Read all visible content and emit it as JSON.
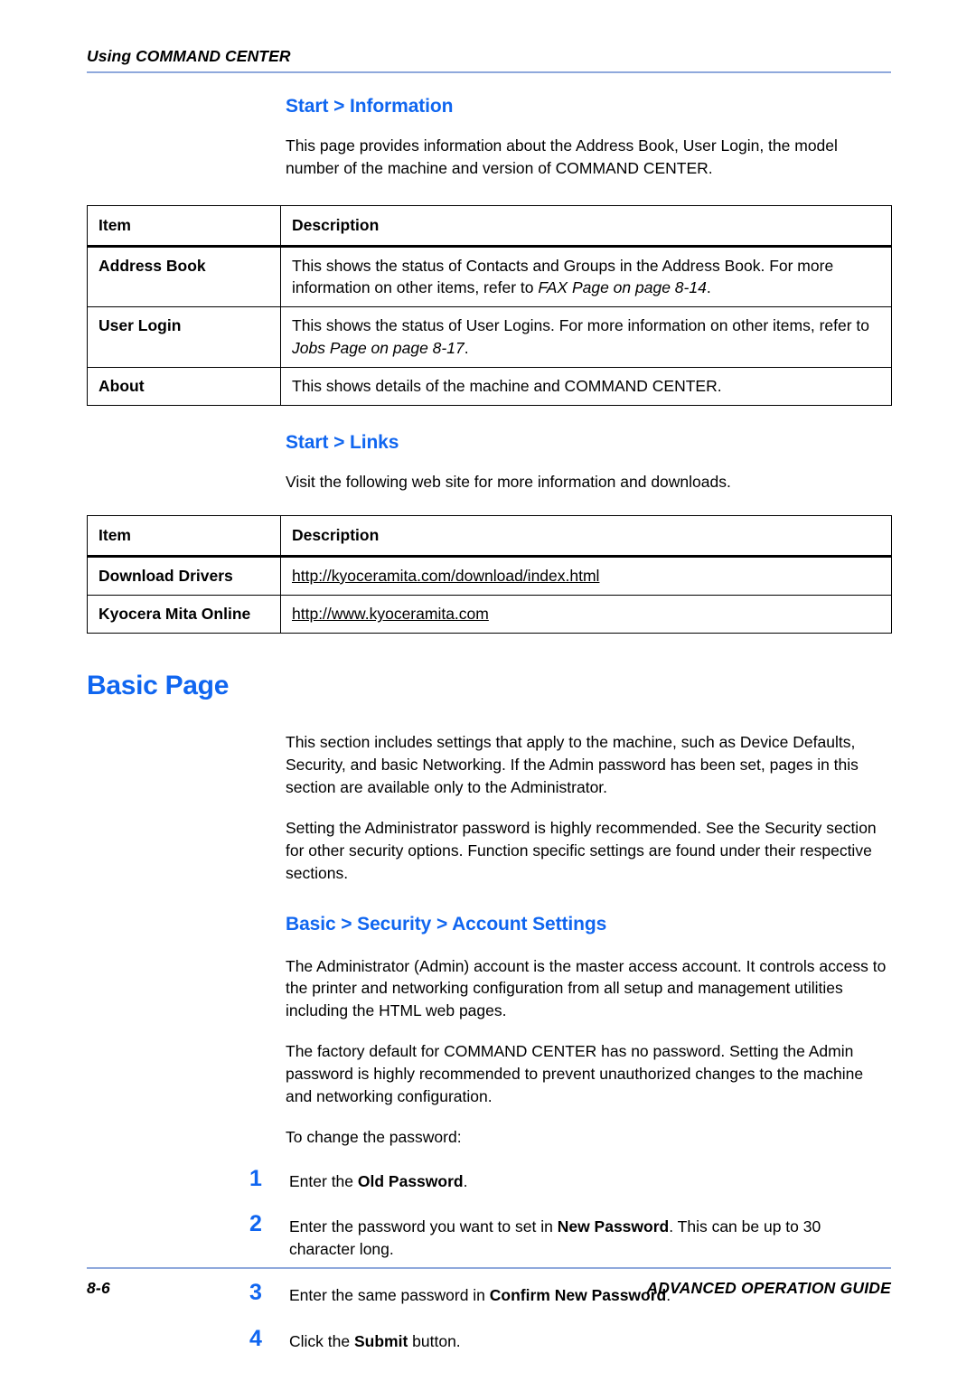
{
  "header": {
    "running_title": "Using COMMAND CENTER",
    "rule_color": "#8FA9DC"
  },
  "colors": {
    "heading_blue": "#1066F0",
    "rule_blue": "#8FA9DC",
    "text_black": "#000000"
  },
  "sections": {
    "start_information": {
      "heading": "Start > Information",
      "intro": "This page provides information about the Address Book, User Login, the model number of the machine and version of COMMAND CENTER.",
      "table": {
        "columns": [
          "Item",
          "Description"
        ],
        "rows": [
          {
            "item": "Address Book",
            "desc_pre": "This shows the status of Contacts and Groups in the Address Book. For more information on other items, refer to ",
            "desc_italic": "FAX Page on page 8-14",
            "desc_post": "."
          },
          {
            "item": "User Login",
            "desc_pre": "This shows the status of User Logins. For more information on other items, refer to ",
            "desc_italic": "Jobs Page on page 8-17",
            "desc_post": "."
          },
          {
            "item": "About",
            "desc_pre": "This shows details of the machine and COMMAND CENTER.",
            "desc_italic": "",
            "desc_post": ""
          }
        ]
      }
    },
    "start_links": {
      "heading": "Start > Links",
      "intro": "Visit the following web site for more information and downloads.",
      "table": {
        "columns": [
          "Item",
          "Description"
        ],
        "rows": [
          {
            "item": "Download Drivers",
            "url": "http://kyoceramita.com/download/index.html"
          },
          {
            "item": "Kyocera Mita Online",
            "url": "http://www.kyoceramita.com"
          }
        ]
      }
    },
    "basic_page": {
      "heading": "Basic Page",
      "paragraph_1": "This section includes settings that apply to the machine, such as Device Defaults, Security, and basic Networking. If the Admin password has been set, pages in this section are available only to the Administrator.",
      "paragraph_2": "Setting the Administrator password is highly recommended. See the Security section for other security options. Function specific settings are found under their respective sections."
    },
    "account_settings": {
      "heading": "Basic > Security > Account Settings",
      "paragraph_1": "The Administrator (Admin) account is the master access account. It controls access to the printer and networking configuration from all setup and management utilities including the HTML web pages.",
      "paragraph_2": "The factory default for COMMAND CENTER has no password. Setting the Admin password is highly recommended to prevent unauthorized changes to the machine and networking configuration.",
      "paragraph_3": "To change the password:",
      "steps": [
        {
          "number": "1",
          "pre": "Enter the ",
          "bold": "Old Password",
          "post": "."
        },
        {
          "number": "2",
          "pre": "Enter the password you want to set in ",
          "bold": "New Password",
          "post": ". This can be up to 30 character long."
        },
        {
          "number": "3",
          "pre": "Enter the same password in ",
          "bold": "Confirm New Password",
          "post": "."
        },
        {
          "number": "4",
          "pre": "Click the ",
          "bold": "Submit",
          "post": " button."
        }
      ]
    }
  },
  "footer": {
    "page_number": "8-6",
    "guide_title": "ADVANCED OPERATION GUIDE"
  }
}
